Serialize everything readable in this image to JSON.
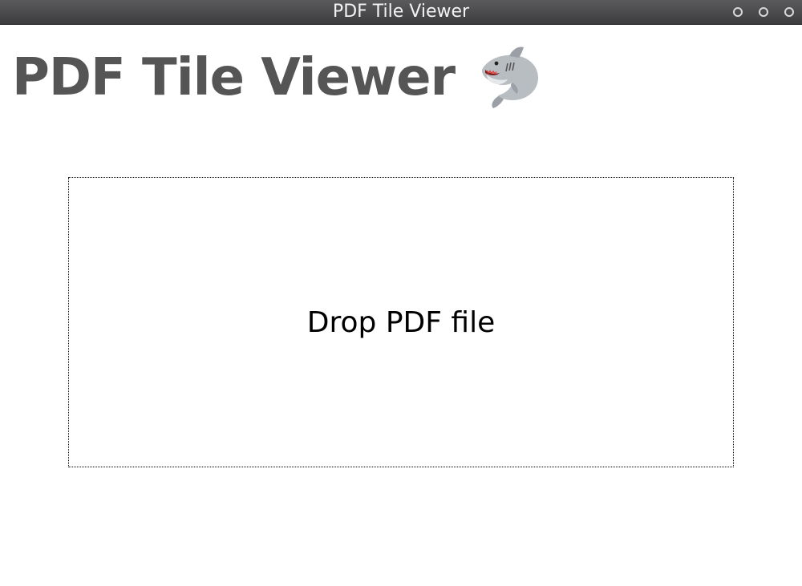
{
  "window": {
    "title": "PDF Tile Viewer",
    "controls": [
      "minimize-icon",
      "maximize-icon",
      "close-icon"
    ]
  },
  "header": {
    "title": "PDF Tile Viewer",
    "logo_icon": "shark-icon"
  },
  "drop_zone": {
    "label": "Drop PDF file"
  },
  "colors": {
    "titlebar": "#4a4a4c",
    "title_text": "#555555",
    "background": "#ffffff"
  }
}
